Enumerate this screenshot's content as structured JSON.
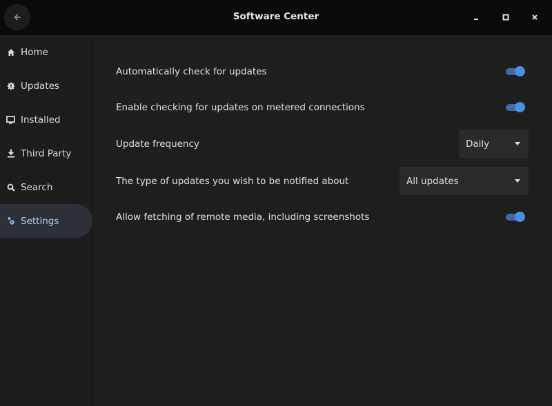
{
  "window": {
    "title": "Software Center",
    "back_icon": "arrow-left-icon",
    "controls": [
      {
        "name": "minimize",
        "icon": "minimize-icon"
      },
      {
        "name": "maximize",
        "icon": "maximize-icon"
      },
      {
        "name": "close",
        "icon": "close-icon"
      }
    ]
  },
  "sidebar": {
    "items": [
      {
        "label": "Home",
        "icon": "home-icon",
        "active": false
      },
      {
        "label": "Updates",
        "icon": "updates-gear-icon",
        "active": false
      },
      {
        "label": "Installed",
        "icon": "monitor-icon",
        "active": false
      },
      {
        "label": "Third Party",
        "icon": "download-icon",
        "active": false
      },
      {
        "label": "Search",
        "icon": "search-icon",
        "active": false
      },
      {
        "label": "Settings",
        "icon": "settings-icon",
        "active": true
      }
    ]
  },
  "settings": {
    "auto_check": {
      "label": "Automatically check for updates",
      "enabled": true
    },
    "metered": {
      "label": "Enable checking for updates on metered connections",
      "enabled": true
    },
    "frequency": {
      "label": "Update frequency",
      "value": "Daily"
    },
    "notify_type": {
      "label": "The type of updates you wish to be notified about",
      "value": "All updates"
    },
    "remote_media": {
      "label": "Allow fetching of remote media, including screenshots",
      "enabled": true
    }
  },
  "colors": {
    "accent": "#4a8fe6",
    "accent_track": "#3f6aa3",
    "titlebar": "#0a0a0a",
    "background": "#1e1e1e",
    "active_nav": "#2d3036"
  }
}
